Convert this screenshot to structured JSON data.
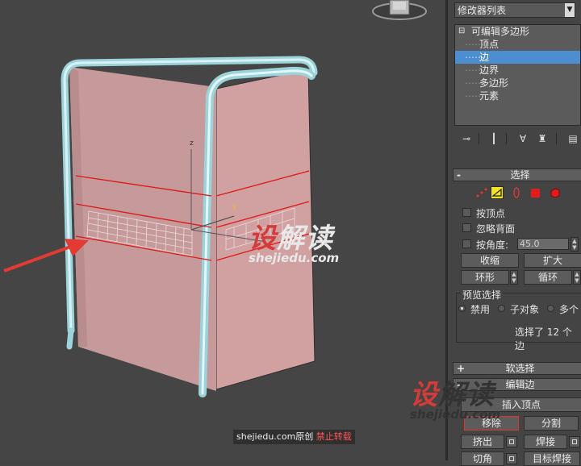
{
  "viewport": {
    "axis_z": "z",
    "axis_y": "y",
    "watermark_top": {
      "part1": "设",
      "part2": "解读",
      "url": "shejiedu.com"
    },
    "watermark_bottom": {
      "part1": "设",
      "part2": "解读",
      "url": "shejiedu.com"
    },
    "credit": {
      "site": "shejiedu.com",
      "original": "原创",
      "warning": "禁止转载"
    }
  },
  "modifier_list": {
    "label": "修改器列表"
  },
  "stack": {
    "root": "可编辑多边形",
    "items": [
      "顶点",
      "边",
      "边界",
      "多边形",
      "元素"
    ],
    "selected": "边"
  },
  "selection_rollout": {
    "title": "选择",
    "by_vertex": "按顶点",
    "ignore_backfacing": "忽略背面",
    "by_angle": "按角度:",
    "angle_value": "45.0",
    "shrink": "收缩",
    "grow": "扩大",
    "ring": "环形",
    "loop": "循环",
    "preview_label": "预览选择",
    "preview_options": [
      "禁用",
      "子对象",
      "多个"
    ],
    "status": "选择了 12 个边"
  },
  "soft_selection": {
    "title": "软选择"
  },
  "edit_edges": {
    "title": "编辑边",
    "insert_vertex": "插入顶点",
    "remove": "移除",
    "split": "分割",
    "extrude": "挤出",
    "weld": "焊接",
    "chamfer": "切角",
    "target_weld": "目标焊接"
  },
  "colors": {
    "viewport_bg": "#454545",
    "object_face": "#d9a5a6",
    "edge_highlight": "#e01818",
    "frame_cyan": "#a9d9df",
    "selected_row": "#4d8ed1",
    "arrow_red": "#e23b34"
  }
}
